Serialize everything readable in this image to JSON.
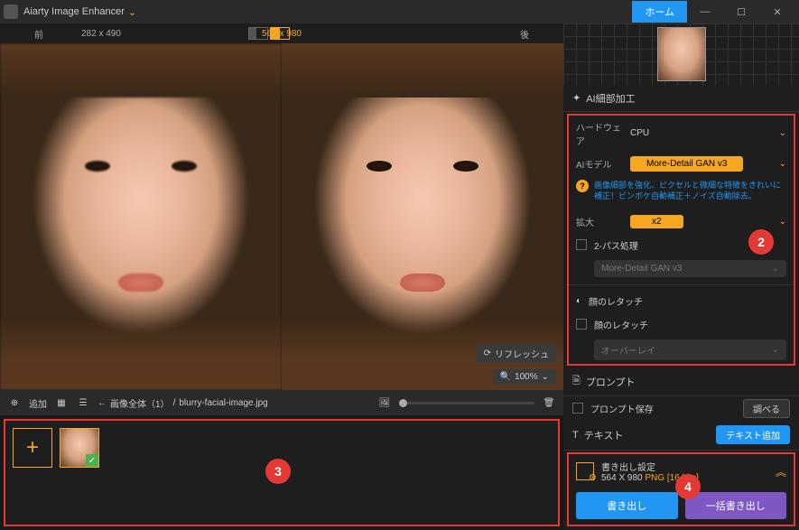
{
  "titlebar": {
    "title": "Aiarty Image Enhancer",
    "home": "ホーム"
  },
  "dims": {
    "before_label": "前",
    "before": "282 x 490",
    "after_label": "後",
    "after": "564 x 980"
  },
  "preview": {
    "refresh": "リフレッシュ",
    "zoom": "100%"
  },
  "footer": {
    "add": "追加",
    "crumb_prefix": "画像全体（1）",
    "crumb_sep": "/",
    "filename": "blurry-facial-image.jpg"
  },
  "panel": {
    "ai_section": "AI細部加工",
    "hardware_label": "ハードウェア",
    "hardware_value": "CPU",
    "model_label": "AIモデル",
    "model_value": "More-Detail GAN  v3",
    "model_desc": "画像細部を強化、ピクセルと微細な特徴をきれいに補正！ピンボケ自動補正＋ノイズ自動除去。",
    "scale_label": "拡大",
    "scale_value": "x2",
    "twopass": "2-パス処理",
    "twopass_model": "More-Detail GAN  v3",
    "face_section": "顔のレタッチ",
    "face_retouch": "顔のレタッチ",
    "face_overlay": "オーバーレイ",
    "prompt_section": "プロンプト",
    "prompt_save": "プロンプト保存",
    "prompt_compare": "調べる",
    "text_section": "テキスト",
    "text_add": "テキスト追加"
  },
  "export": {
    "title": "書き出し設定",
    "dims": "564 X 980",
    "format": "PNG   [16 bits]",
    "btn1": "書き出し",
    "btn2": "一括書き出し"
  },
  "badges": {
    "b2": "2",
    "b3": "3",
    "b4": "4"
  }
}
